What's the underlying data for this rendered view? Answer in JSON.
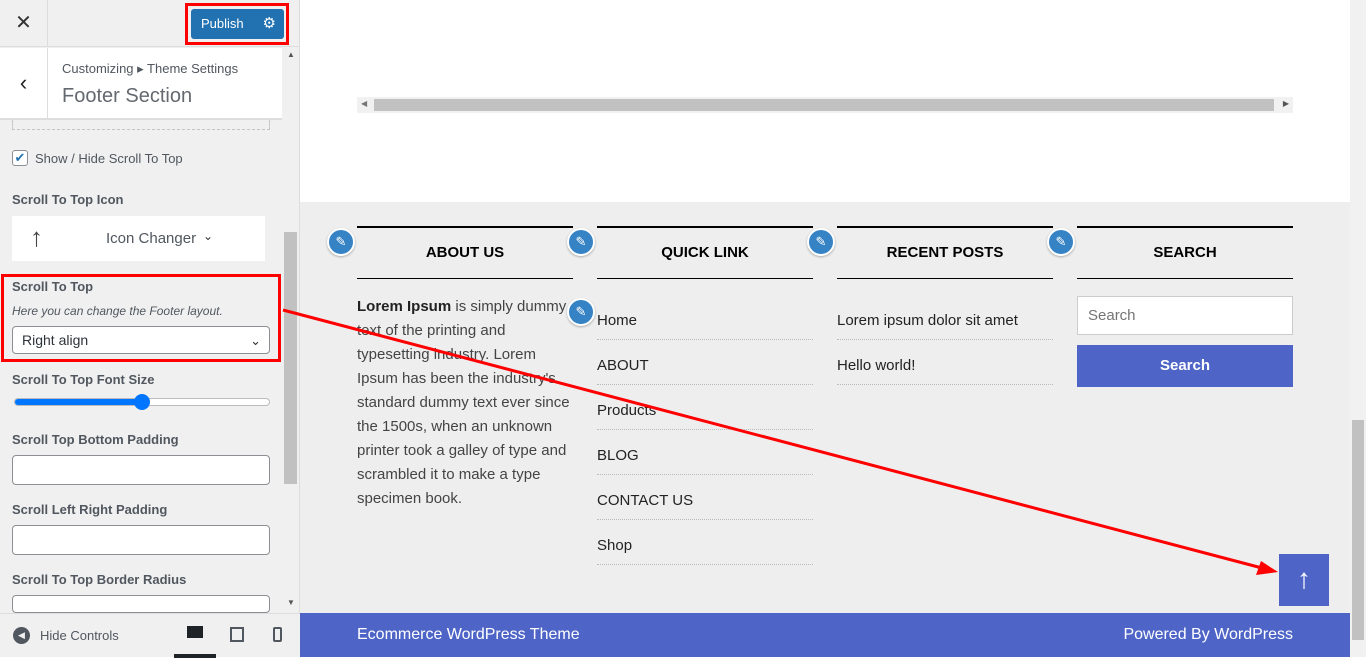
{
  "sidebar": {
    "close_icon": "close-icon",
    "publish": "Publish",
    "gear_icon": "gear-icon",
    "breadcrumb": "Customizing ▸ Theme Settings",
    "title": "Footer Section",
    "show_hide_label": "Show / Hide Scroll To Top",
    "show_hide_checked": true,
    "icon_label": "Scroll To Top Icon",
    "icon_changer": "Icon Changer",
    "scroll_label": "Scroll To Top",
    "scroll_desc": "Here you can change the Footer layout.",
    "scroll_value": "Right align",
    "font_size_label": "Scroll To Top Font Size",
    "font_size_percent": 50,
    "bottom_padding_label": "Scroll Top Bottom Padding",
    "lr_padding_label": "Scroll Left Right Padding",
    "radius_label": "Scroll To Top Border Radius",
    "hide_controls": "Hide Controls"
  },
  "footer": {
    "about": {
      "title": "ABOUT US",
      "bold": "Lorem Ipsum",
      "text": " is simply dummy text of the printing and typesetting industry. Lorem Ipsum has been the industry's standard dummy text ever since the 1500s, when an unknown printer took a galley of type and scrambled it to make a type specimen book."
    },
    "quick": {
      "title": "QUICK LINK",
      "links": [
        "Home",
        "ABOUT",
        "Products",
        "BLOG",
        "CONTACT US",
        "Shop"
      ]
    },
    "recent": {
      "title": "RECENT POSTS",
      "posts": [
        "Lorem ipsum dolor sit amet",
        "Hello world!"
      ]
    },
    "search": {
      "title": "SEARCH",
      "placeholder": "Search",
      "button": "Search"
    },
    "left_text": "Ecommerce WordPress Theme",
    "right_text": "Powered By WordPress"
  },
  "colors": {
    "accent": "#4e65c7",
    "publish": "#2271b1",
    "annotation": "#ff0000"
  }
}
